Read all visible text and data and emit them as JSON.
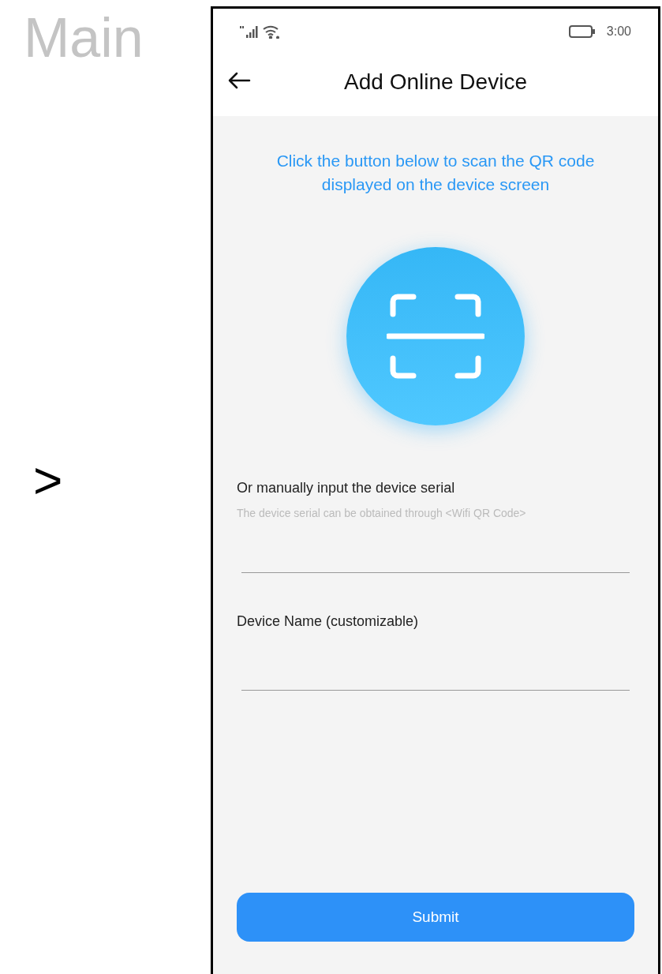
{
  "page_label": "Main",
  "arrow_glyph": ">",
  "status_bar": {
    "time": "3:00"
  },
  "header": {
    "title": "Add Online Device"
  },
  "scan_hint": "Click the button below to scan the QR code displayed on the device screen",
  "serial": {
    "label": "Or manually input the device serial",
    "hint": "The device serial can be obtained through <Wifi QR Code>"
  },
  "device_name": {
    "label": "Device Name (customizable)"
  },
  "submit": "Submit"
}
